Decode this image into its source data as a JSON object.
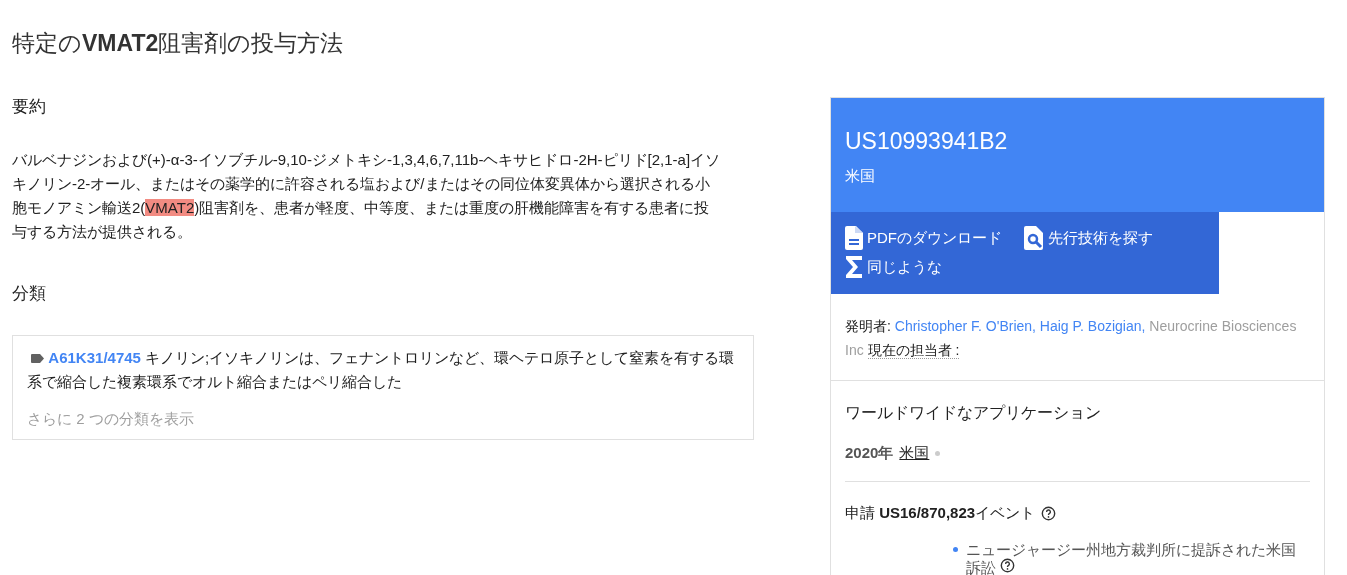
{
  "title": "特定の**VMAT2**阻害剤の投与方法",
  "abstract": {
    "heading": "要約",
    "parts": [
      {
        "text": "バルベナジンおよび(+)-α-3-イソブチル-9,10-ジメトキシ-1,3,4,6,7,11b-ヘキサヒドロ-2H-ピリド[2,1-a]イソキノリン-2-オール、またはその薬学的に許容される塩および/またはその同位体変異体から選択される小胞モノアミン輸送2(",
        "highlighted": false
      },
      {
        "text": "VMAT2",
        "highlighted": true
      },
      {
        "text": ")阻害剤を、患者が軽度、中等度、または重度の肝機能障害を有する患者に投与する方法が提供される。",
        "highlighted": false
      }
    ]
  },
  "classifications": {
    "heading": "分類",
    "items": [
      {
        "code": "A61K31/4745",
        "description": "キノリン;イソキノリンは、フェナントロリンなど、環ヘテロ原子として窒素を有する環系で縮合した複素環系でオルト縮合またはペリ縮合した"
      }
    ],
    "more": "さらに 2 つの分類を表示"
  },
  "patent": {
    "number": "US10993941B2",
    "country": "米国",
    "actions": [
      {
        "kind": "pdf",
        "label": "PDFのダウンロード"
      },
      {
        "kind": "prior-art",
        "label": "先行技術を探す"
      },
      {
        "kind": "similar",
        "label": "同じような"
      }
    ],
    "inventors_label": "発明者:",
    "inventors": [
      "Christopher F. O'Brien,",
      "Haig P. Bozigian,"
    ],
    "assignee": "Neurocrine Biosciences Inc",
    "assignee_label": "現在の担当者 :",
    "worldwide": {
      "heading": "ワールドワイドなアプリケーション",
      "year": "2020年",
      "country": "米国"
    },
    "application": {
      "text": "申請 **US16/870,823**イベント",
      "events": [
        "ニュージャージー州地方裁判所に提訴された米国訴訟"
      ]
    }
  }
}
